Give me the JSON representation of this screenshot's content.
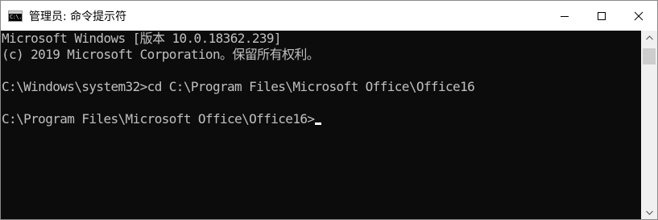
{
  "window": {
    "title": "管理员: 命令提示符",
    "icon": "cmd-icon",
    "icon_text": "C:\\."
  },
  "title_controls": [
    {
      "name": "minimize",
      "icon": "minimize-icon"
    },
    {
      "name": "maximize",
      "icon": "maximize-icon"
    },
    {
      "name": "close",
      "icon": "close-icon"
    }
  ],
  "console": {
    "lines": [
      "Microsoft Windows [版本 10.0.18362.239]",
      "(c) 2019 Microsoft Corporation。保留所有权利。",
      "",
      "C:\\Windows\\system32>cd C:\\Program Files\\Microsoft Office\\Office16",
      "",
      "C:\\Program Files\\Microsoft Office\\Office16>"
    ],
    "text_color": "#c0c0c0",
    "background": "#0c0c0c"
  },
  "scrollbar": {
    "up_icon": "scroll-up-arrow-icon",
    "down_icon": "scroll-down-arrow-icon"
  }
}
